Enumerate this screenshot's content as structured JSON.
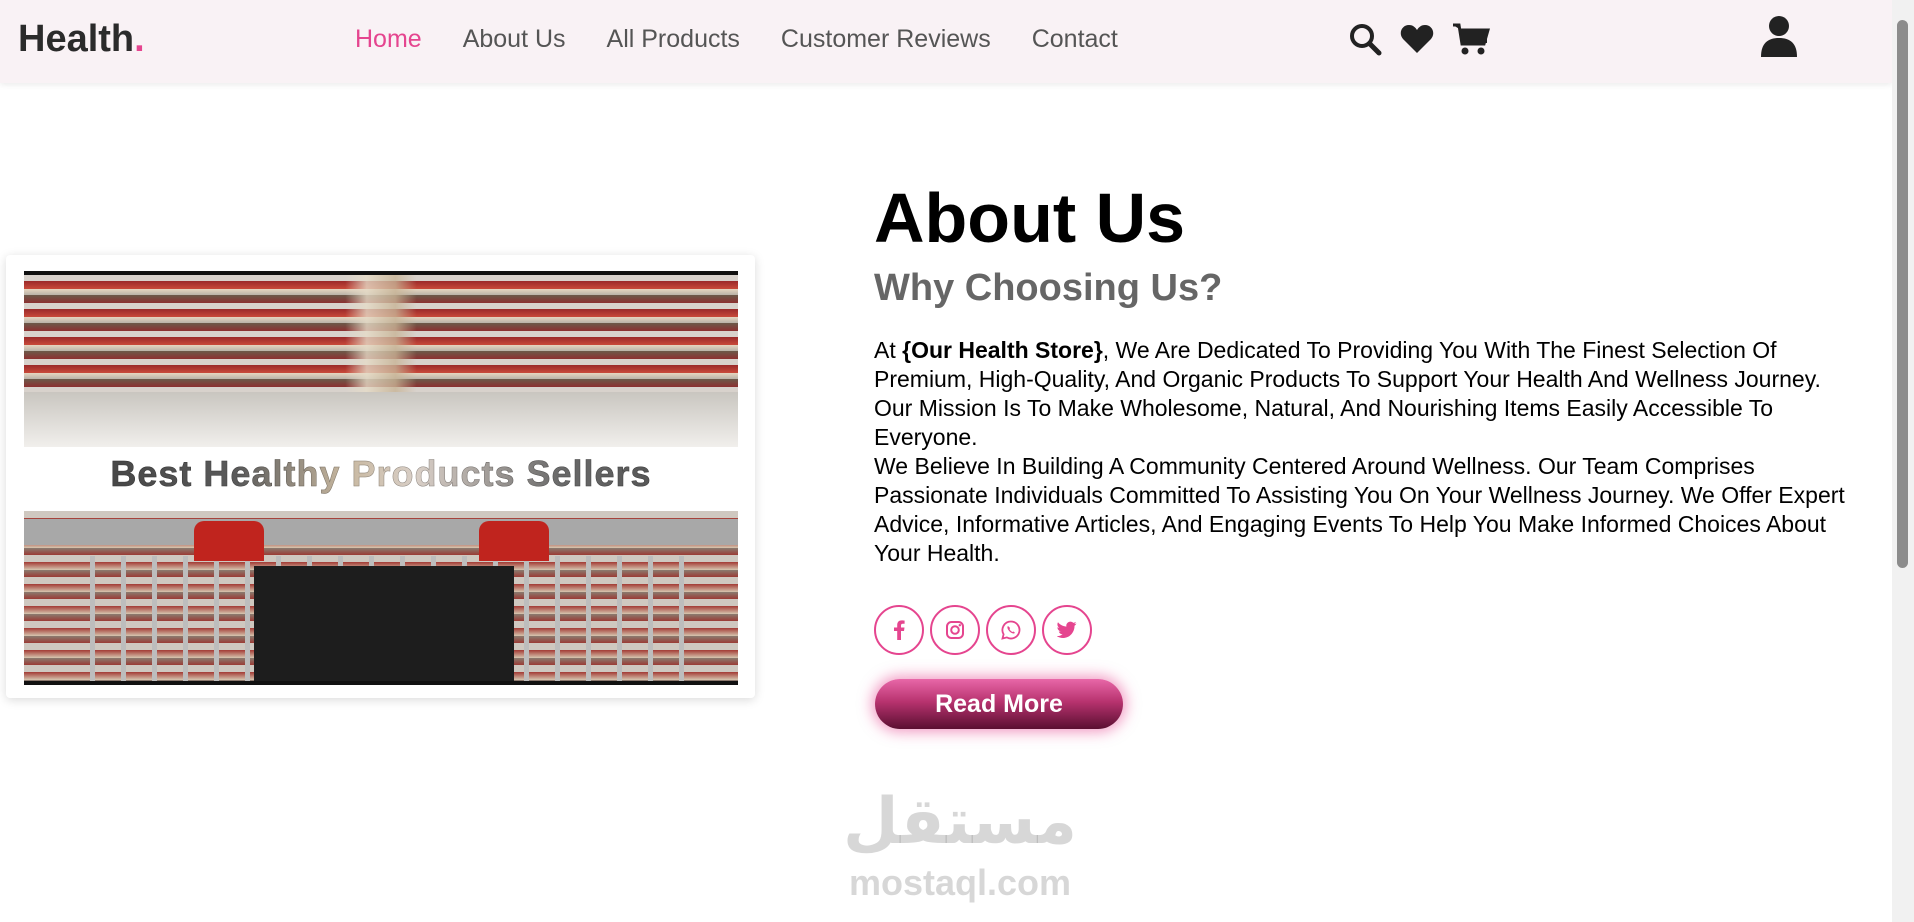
{
  "header": {
    "logo_text": "Health",
    "logo_dot": ".",
    "nav": [
      {
        "label": "Home",
        "active": true
      },
      {
        "label": "About Us",
        "active": false
      },
      {
        "label": "All Products",
        "active": false
      },
      {
        "label": "Customer Reviews",
        "active": false
      },
      {
        "label": "Contact",
        "active": false
      }
    ],
    "icons": [
      "search-icon",
      "heart-icon",
      "cart-icon",
      "user-icon"
    ]
  },
  "card": {
    "banner_title": "Best Healthy Products Sellers"
  },
  "about": {
    "title": "About Us",
    "subtitle": "Why Choosing Us?",
    "para1_prefix": "At ",
    "store_name": "{Our Health Store}",
    "para1_rest": ", We Are Dedicated To Providing You With The Finest Selection Of Premium, High-Quality, And Organic Products To Support Your Health And Wellness Journey. Our Mission Is To Make Wholesome, Natural, And Nourishing Items Easily Accessible To Everyone.",
    "para2": "We Believe In Building A Community Centered Around Wellness. Our Team Comprises Passionate Individuals Committed To Assisting You On Your Wellness Journey. We Offer Expert Advice, Informative Articles, And Engaging Events To Help You Make Informed Choices About Your Health.",
    "socials": [
      "facebook-icon",
      "instagram-icon",
      "whatsapp-icon",
      "twitter-icon"
    ],
    "read_more": "Read More"
  },
  "watermark": {
    "arabic": "مستقل",
    "latin": "mostaql.com"
  },
  "colors": {
    "accent": "#e5458f",
    "header_bg": "#f9f2f5"
  }
}
